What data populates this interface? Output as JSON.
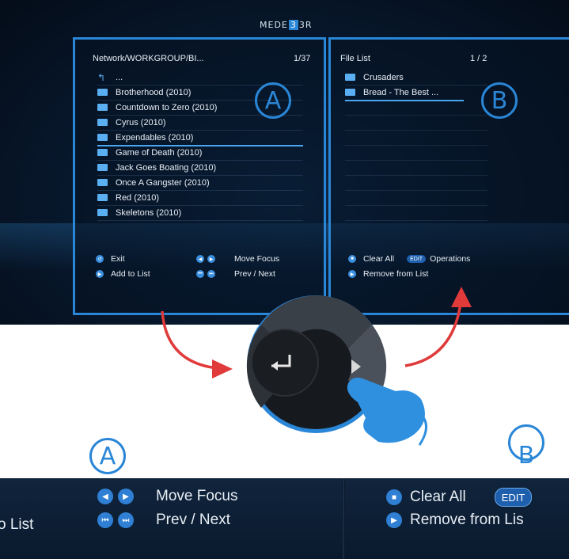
{
  "logo": {
    "left": "MEDE",
    "mid": "3",
    "right": "3R"
  },
  "panel_a": {
    "path": "Network/WORKGROUP/BI...",
    "count": "1/37",
    "up_item": "...",
    "items": [
      "Brotherhood (2010)",
      "Countdown to Zero (2010)",
      "Cyrus (2010)",
      "Expendables (2010)",
      "Game of Death (2010)",
      "Jack Goes Boating (2010)",
      "Once A Gangster (2010)",
      "Red (2010)",
      "Skeletons (2010)"
    ],
    "selected_index": 3,
    "hints": {
      "exit": "Exit",
      "add": "Add to List",
      "move_focus": "Move Focus",
      "prev_next": "Prev / Next"
    }
  },
  "panel_b": {
    "title": "File List",
    "count": "1 / 2",
    "items": [
      "Crusaders",
      "Bread - The Best ..."
    ],
    "selected_index": 1,
    "hints": {
      "clear_all": "Clear All",
      "edit": "EDIT",
      "operations": "Operations",
      "remove": "Remove from List"
    }
  },
  "labels": {
    "a": "A",
    "b": "B"
  },
  "zoom": {
    "move_focus": "Move Focus",
    "prev_next": "Prev / Next",
    "list_fragment": "o List",
    "clear_all": "Clear All",
    "edit": "EDIT",
    "remove": "Remove from Lis"
  },
  "icons": {
    "exit": "return-icon",
    "add": "play-pause-icon",
    "left": "arrow-left-icon",
    "right": "arrow-right-icon",
    "prev": "skip-prev-icon",
    "next": "skip-next-icon",
    "stop": "stop-icon",
    "folder": "folder-icon",
    "hand": "hand-press-icon"
  },
  "colors": {
    "accent": "#2a86d6",
    "arrow": "#e03a3a",
    "bg": "#081a30"
  }
}
